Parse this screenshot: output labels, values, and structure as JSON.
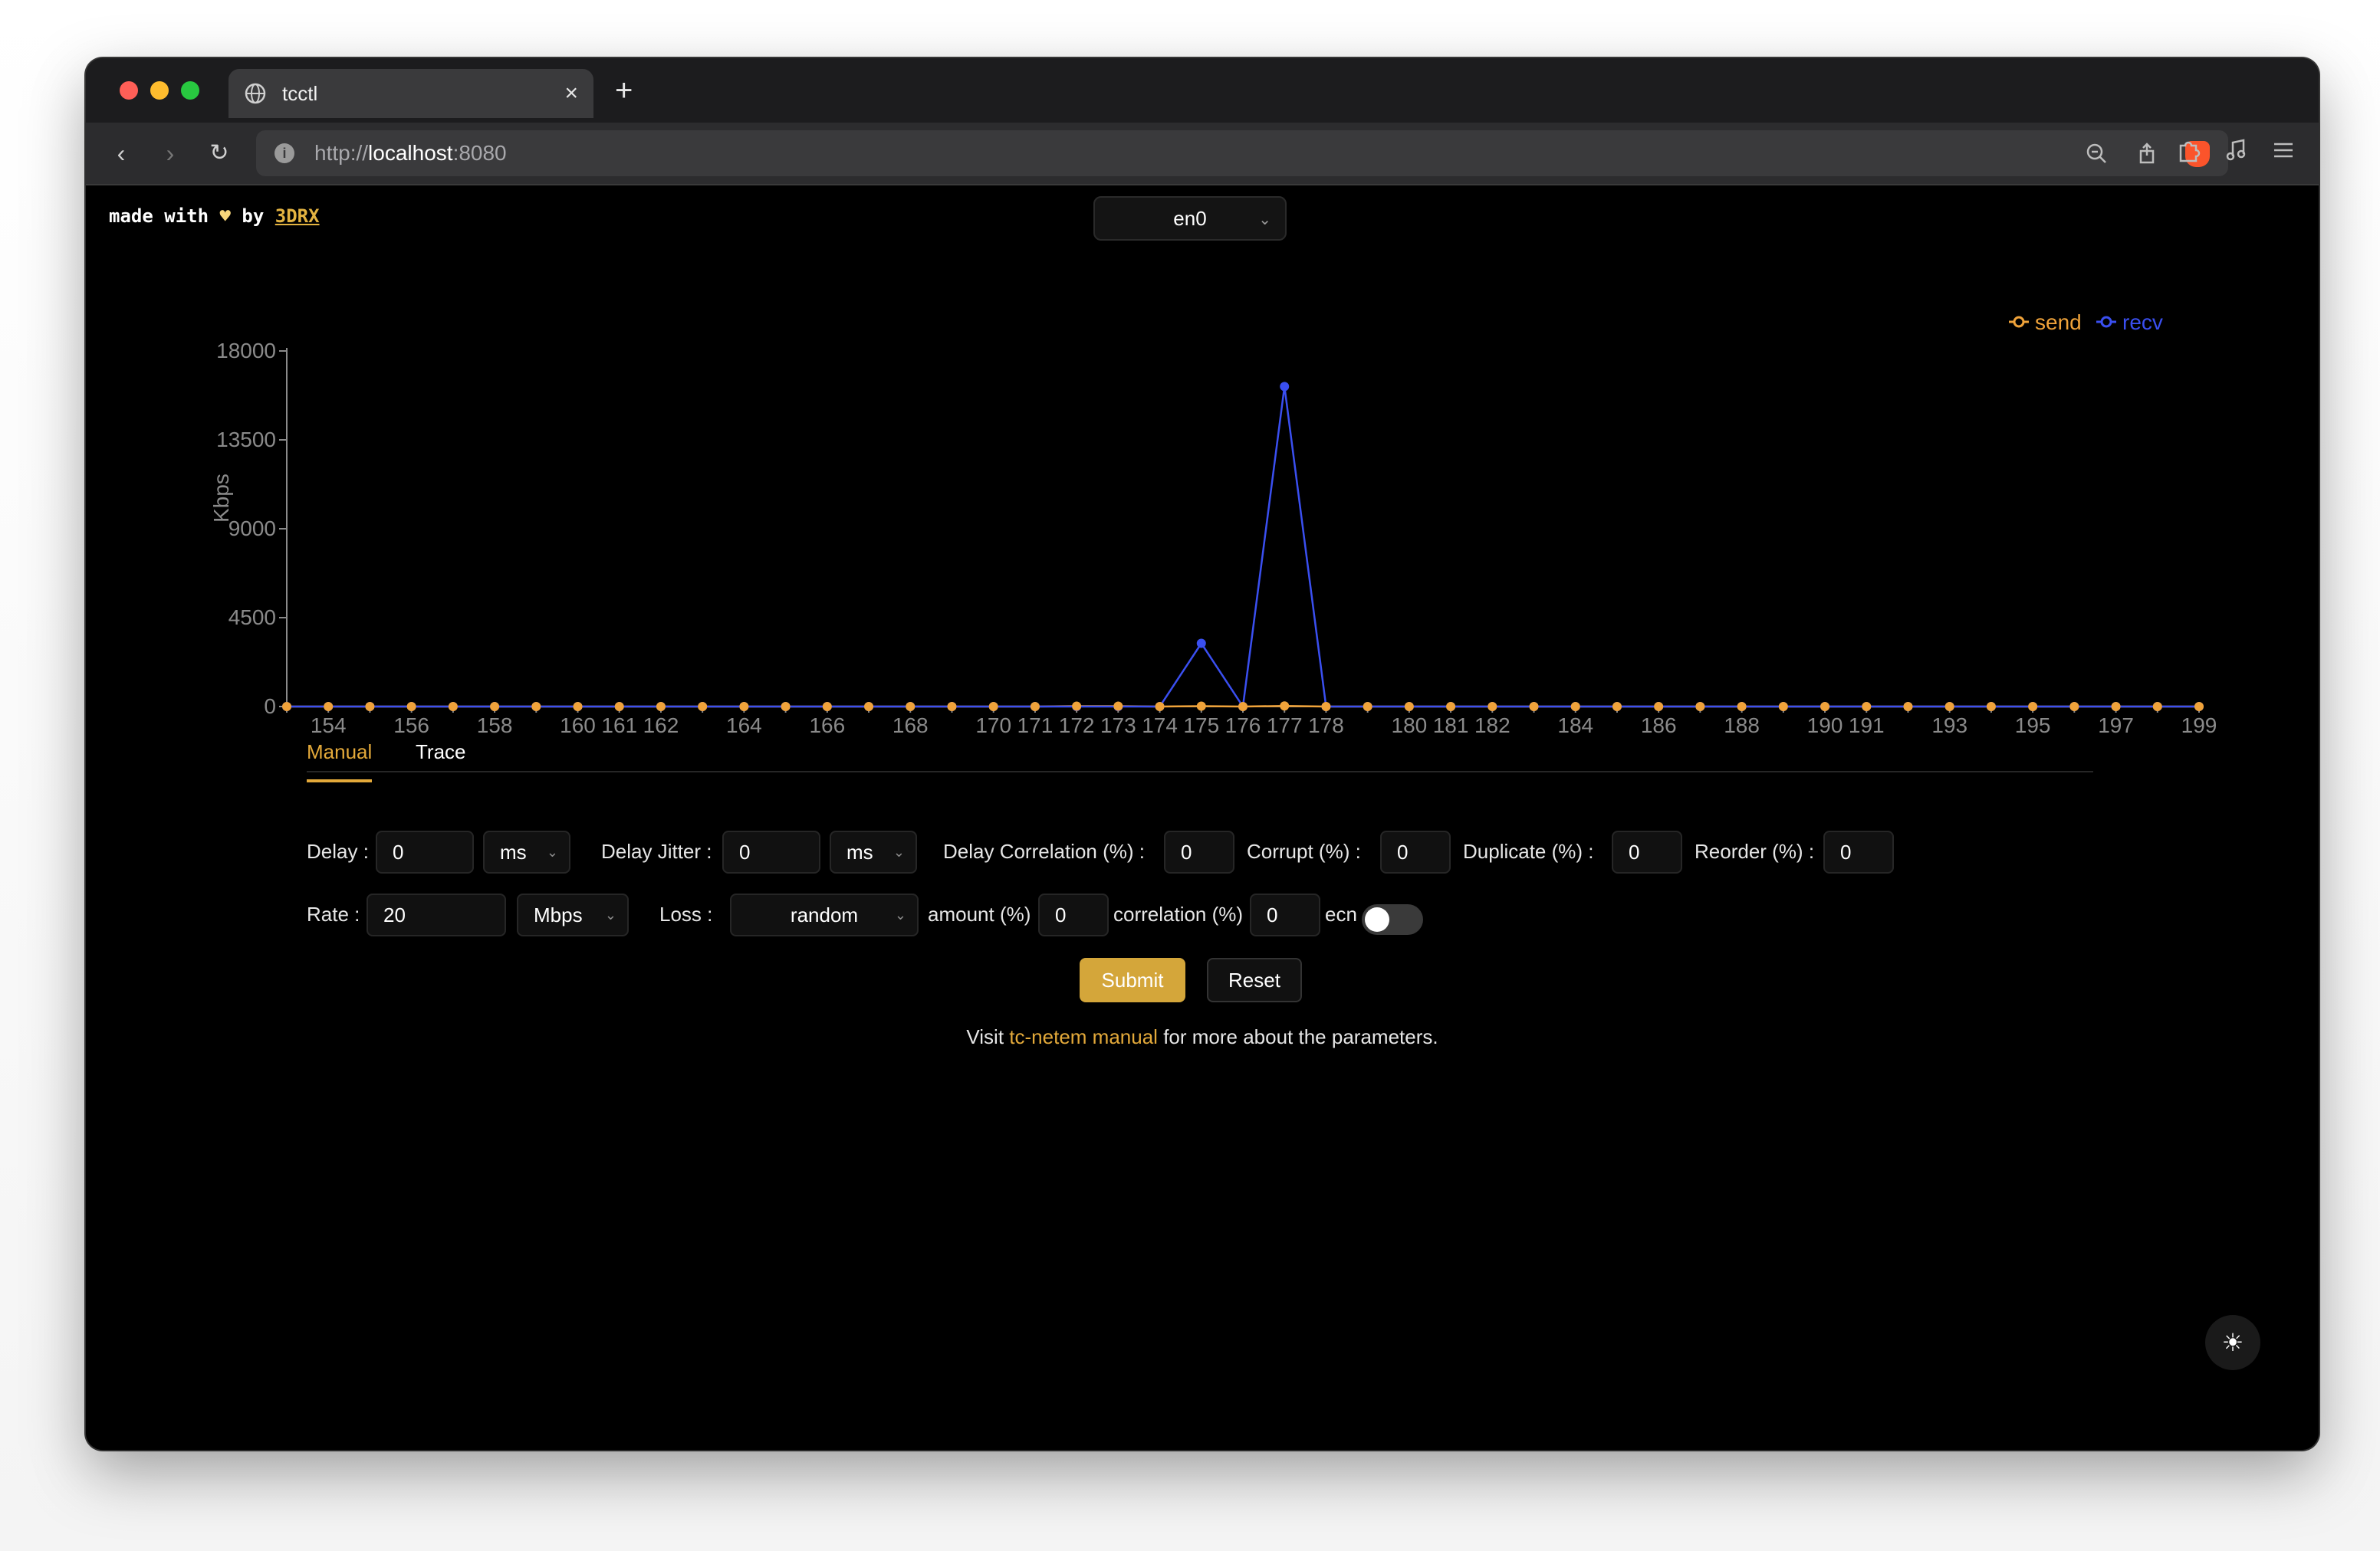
{
  "browser": {
    "tab_title": "tcctl",
    "url_scheme": "http://",
    "url_host": "localhost",
    "url_port": ":8080",
    "close_glyph": "×",
    "new_tab_glyph": "+"
  },
  "header": {
    "made_with": "made with",
    "heart": "♥",
    "by": "by",
    "author": "3DRX",
    "interface": "en0"
  },
  "chart_data": {
    "type": "line",
    "title": "",
    "xlabel": "",
    "ylabel": "Kbps",
    "ylim": [
      0,
      18000
    ],
    "yticks": [
      0,
      4500,
      9000,
      13500,
      18000
    ],
    "legend_position": "top-right",
    "x": [
      153,
      154,
      155,
      156,
      157,
      158,
      159,
      160,
      161,
      162,
      163,
      164,
      165,
      166,
      167,
      168,
      169,
      170,
      171,
      172,
      173,
      174,
      175,
      176,
      177,
      178,
      179,
      180,
      181,
      182,
      183,
      184,
      185,
      186,
      187,
      188,
      189,
      190,
      191,
      192,
      193,
      194,
      195,
      196,
      197,
      198,
      199
    ],
    "xtick_labels": [
      154,
      156,
      158,
      160,
      161,
      162,
      164,
      166,
      168,
      170,
      171,
      172,
      173,
      174,
      175,
      176,
      177,
      178,
      180,
      181,
      182,
      184,
      186,
      188,
      190,
      191,
      193,
      195,
      197,
      199
    ],
    "series": [
      {
        "name": "send",
        "color": "#f0a33a",
        "values": [
          0,
          0,
          0,
          0,
          0,
          0,
          0,
          0,
          0,
          0,
          0,
          0,
          0,
          0,
          0,
          0,
          0,
          0,
          0,
          20,
          20,
          0,
          20,
          0,
          30,
          0,
          0,
          0,
          0,
          0,
          0,
          0,
          0,
          0,
          0,
          0,
          0,
          0,
          0,
          0,
          0,
          0,
          0,
          0,
          0,
          0,
          0
        ]
      },
      {
        "name": "recv",
        "color": "#3a4ff0",
        "values": [
          0,
          0,
          0,
          0,
          0,
          0,
          0,
          0,
          0,
          0,
          0,
          0,
          0,
          0,
          0,
          0,
          0,
          0,
          0,
          0,
          0,
          0,
          3200,
          0,
          16200,
          0,
          0,
          0,
          0,
          0,
          0,
          0,
          0,
          0,
          0,
          0,
          0,
          0,
          0,
          0,
          0,
          0,
          0,
          0,
          0,
          0,
          0
        ]
      }
    ]
  },
  "tabs": {
    "manual": "Manual",
    "trace": "Trace"
  },
  "form": {
    "delay_label": "Delay",
    "delay_value": "0",
    "delay_unit": "ms",
    "jitter_label": "Delay Jitter",
    "jitter_value": "0",
    "jitter_unit": "ms",
    "delay_corr_label": "Delay Correlation (%)",
    "delay_corr_value": "0",
    "corrupt_label": "Corrupt (%)",
    "corrupt_value": "0",
    "duplicate_label": "Duplicate (%)",
    "duplicate_value": "0",
    "reorder_label": "Reorder (%)",
    "reorder_value": "0",
    "rate_label": "Rate",
    "rate_value": "20",
    "rate_unit": "Mbps",
    "loss_label": "Loss",
    "loss_value": "random",
    "amount_label": "amount (%)",
    "amount_value": "0",
    "correlation_label": "correlation (%)",
    "correlation_value": "0",
    "ecn_label": "ecn",
    "colon": ":",
    "submit": "Submit",
    "reset": "Reset"
  },
  "footer": {
    "visit": "Visit",
    "link": "tc-netem manual",
    "rest": "for more about the parameters."
  }
}
